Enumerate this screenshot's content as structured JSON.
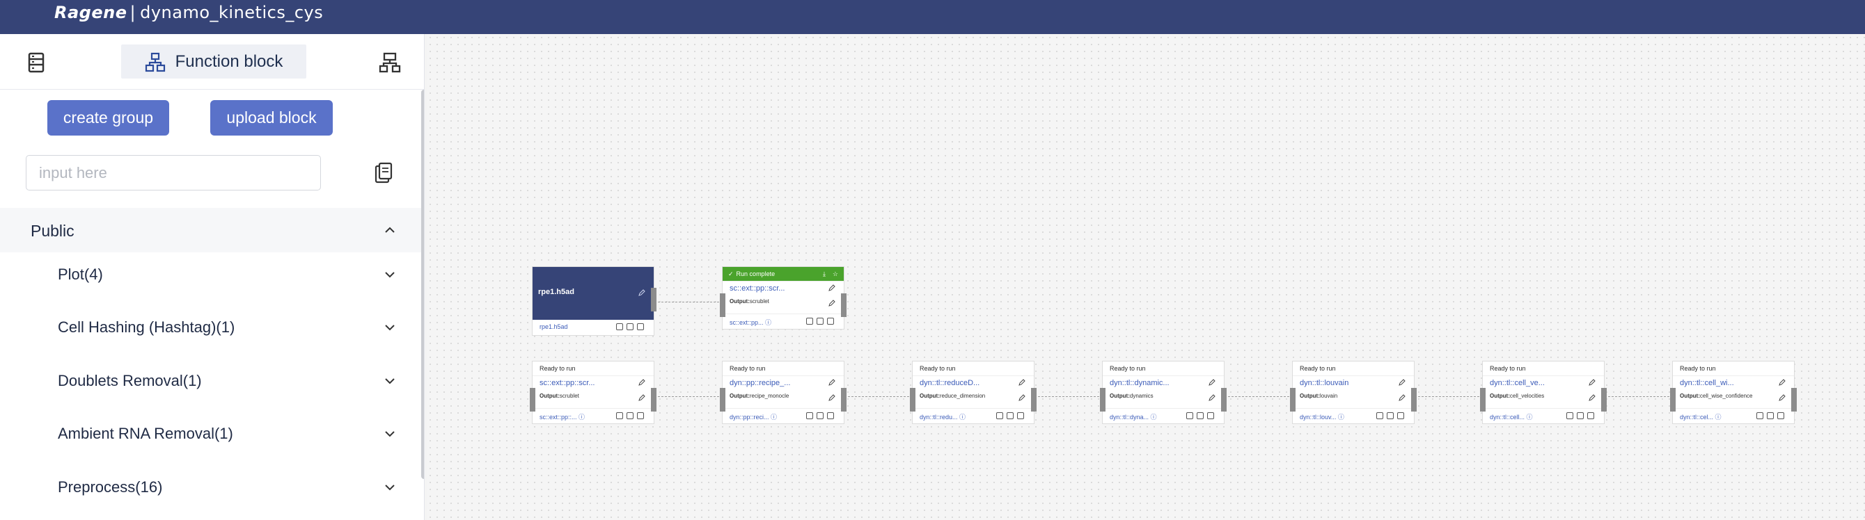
{
  "topbar": {
    "brand": "Ragene",
    "separator": "|",
    "project": "dynamo_kinetics_cys"
  },
  "sidebar": {
    "active_tab": "Function block",
    "buttons": {
      "create_group": "create group",
      "upload_block": "upload block"
    },
    "search_placeholder": "input here",
    "section": "Public",
    "categories": [
      "Plot(4)",
      "Cell Hashing (Hashtag)(1)",
      "Doublets Removal(1)",
      "Ambient RNA Removal(1)",
      "Preprocess(16)"
    ]
  },
  "canvas": {
    "source": {
      "title": "rpe1.h5ad",
      "footer": "rpe1.h5ad"
    },
    "top_node": {
      "status": "Run complete",
      "name": "sc::ext::pp::scr...",
      "output_label": "Output:",
      "output_value": "scrublet",
      "footer": "sc::ext::pp..."
    },
    "pipeline": [
      {
        "status": "Ready to run",
        "name": "sc::ext::pp::scr...",
        "output_label": "Output:",
        "output_value": "scrublet",
        "footer": "sc::ext::pp::..."
      },
      {
        "status": "Ready to run",
        "name": "dyn::pp::recipe_...",
        "output_label": "Output:",
        "output_value": "recipe_monocle",
        "footer": "dyn::pp::reci..."
      },
      {
        "status": "Ready to run",
        "name": "dyn::tl::reduceD...",
        "output_label": "Output:",
        "output_value": "reduce_dimension",
        "footer": "dyn::tl::redu..."
      },
      {
        "status": "Ready to run",
        "name": "dyn::tl::dynamic...",
        "output_label": "Output:",
        "output_value": "dynamics",
        "footer": "dyn::tl::dyna..."
      },
      {
        "status": "Ready to run",
        "name": "dyn::tl::louvain",
        "output_label": "Output:",
        "output_value": "louvain",
        "footer": "dyn::tl::louv..."
      },
      {
        "status": "Ready to run",
        "name": "dyn::tl::cell_ve...",
        "output_label": "Output:",
        "output_value": "cell_velocities",
        "footer": "dyn::tl::cell..."
      },
      {
        "status": "Ready to run",
        "name": "dyn::tl::cell_wi...",
        "output_label": "Output:",
        "output_value": "cell_wise_confidence",
        "footer": "dyn::tl::cel..."
      }
    ]
  },
  "colors": {
    "topbar": "#364477",
    "button": "#5a72c9",
    "run_complete": "#4aa32c",
    "link": "#3b5bb8"
  }
}
